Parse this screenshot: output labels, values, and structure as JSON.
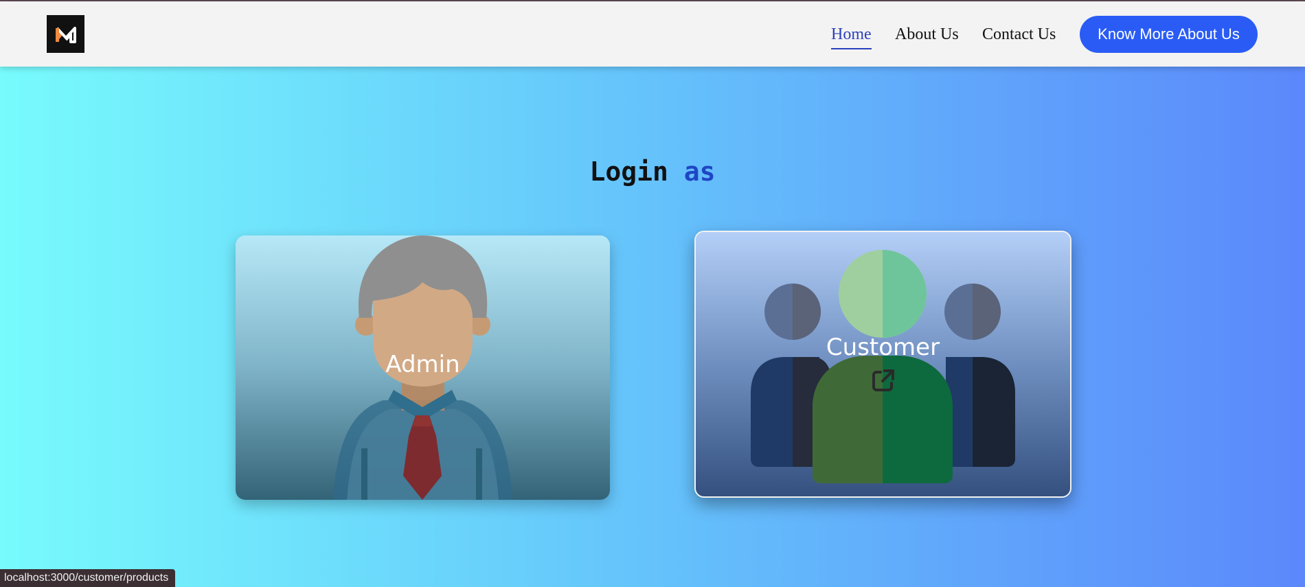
{
  "nav": {
    "logo_alt": "M",
    "links": [
      {
        "label": "Home",
        "active": true
      },
      {
        "label": "About Us",
        "active": false
      },
      {
        "label": "Contact Us",
        "active": false
      }
    ],
    "cta_label": "Know More About Us",
    "accent_color": "#2a5cf5"
  },
  "main": {
    "heading_word": "Login",
    "heading_accent": "as",
    "cards": [
      {
        "label": "Admin",
        "icon": "admin-avatar-icon"
      },
      {
        "label": "Customer",
        "icon": "customers-group-icon",
        "link_icon": "external-link-icon"
      }
    ]
  },
  "status_bar": {
    "url": "localhost:3000/customer/products"
  }
}
